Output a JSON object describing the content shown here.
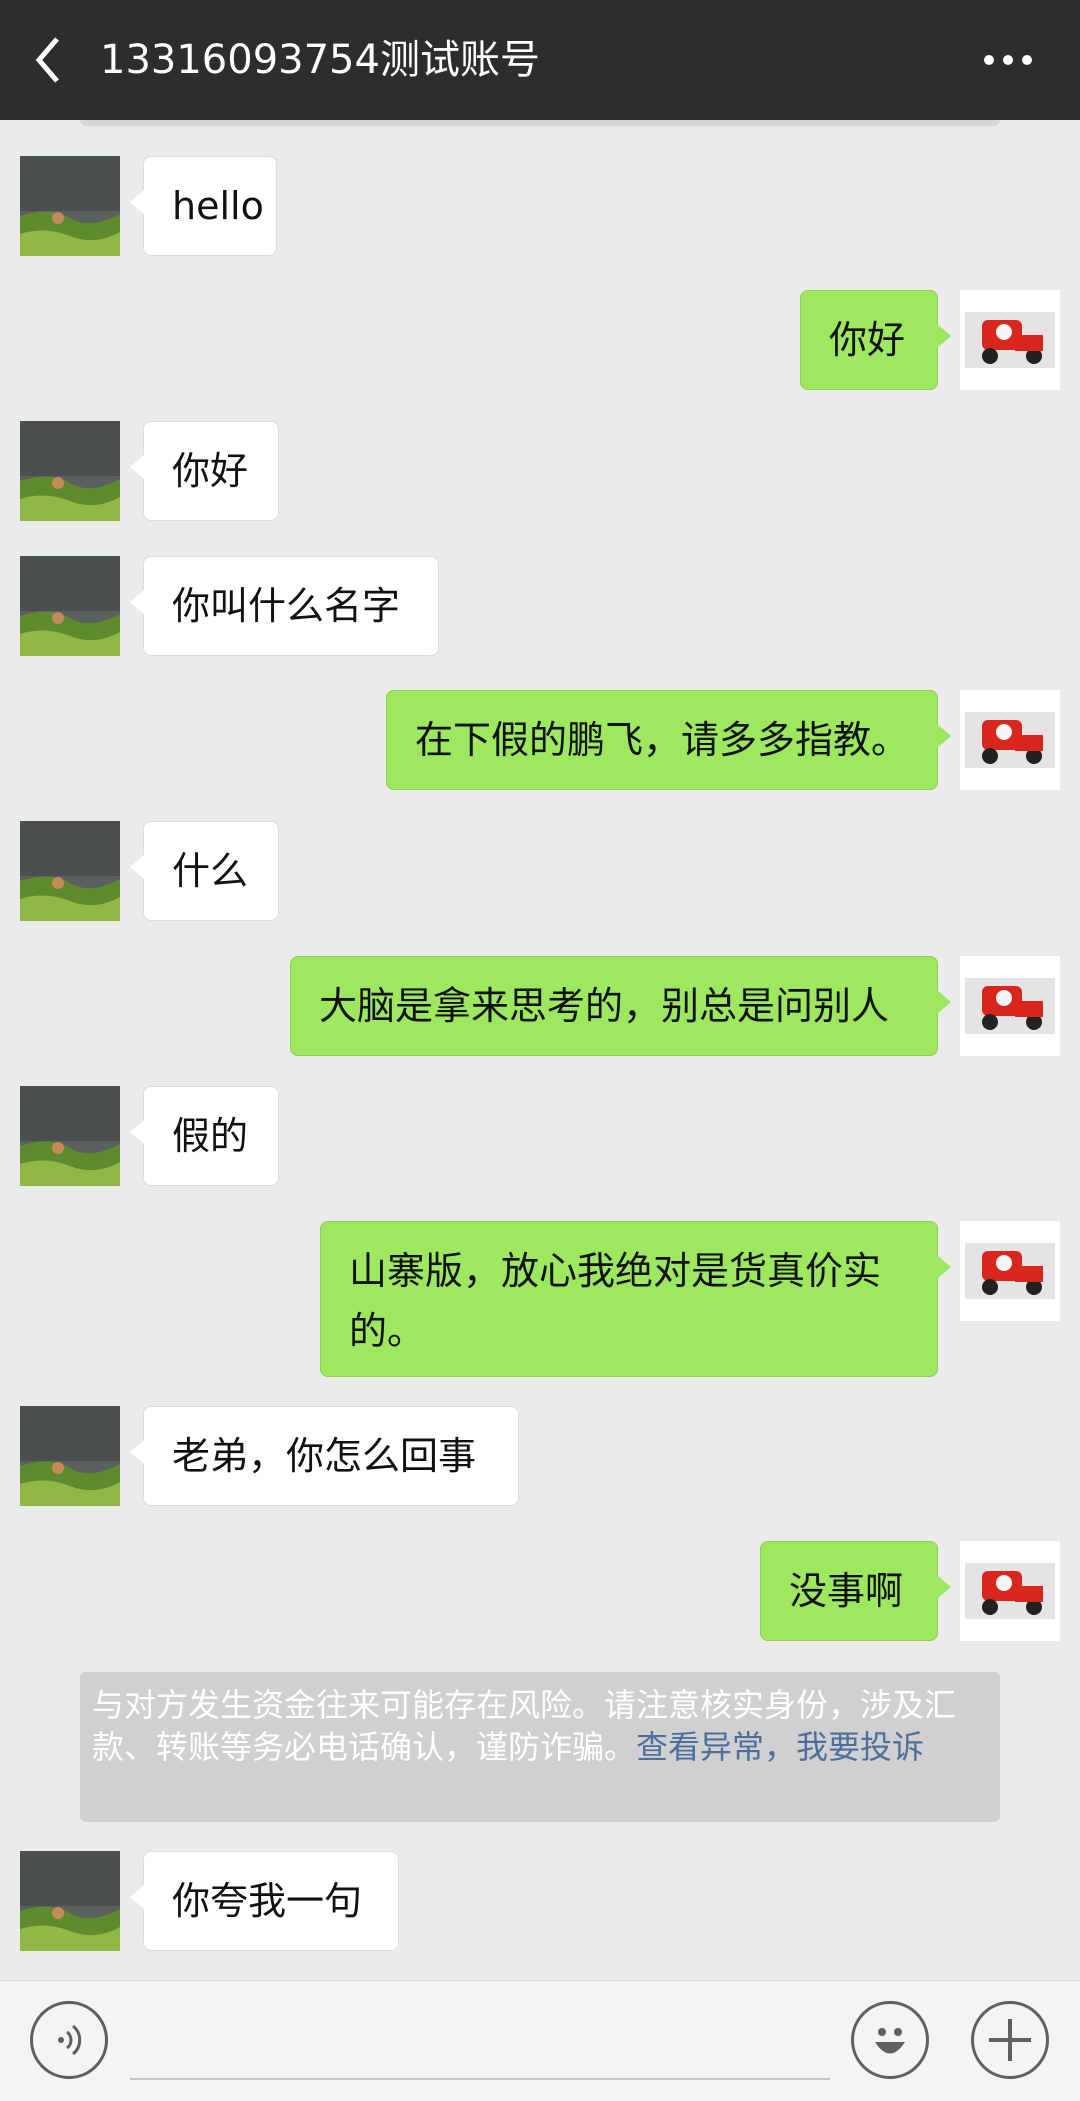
{
  "header": {
    "title": "13316093754测试账号"
  },
  "messages": [
    {
      "side": "left",
      "text": "hello"
    },
    {
      "side": "right",
      "text": "你好"
    },
    {
      "side": "left",
      "text": "你好"
    },
    {
      "side": "left",
      "text": "你叫什么名字"
    },
    {
      "side": "right",
      "text": "在下假的鹏飞，请多多指教。"
    },
    {
      "side": "left",
      "text": "什么"
    },
    {
      "side": "right",
      "text": "大脑是拿来思考的，别总是问别人"
    },
    {
      "side": "left",
      "text": "假的"
    },
    {
      "side": "right",
      "text": "山寨版，放心我绝对是货真价实的。"
    },
    {
      "side": "left",
      "text": "老弟，你怎么回事"
    },
    {
      "side": "right",
      "text": "没事啊"
    },
    {
      "side": "left",
      "text": "你夸我一句"
    }
  ],
  "notice": {
    "text": "与对方发生资金往来可能存在风险。请注意核实身份，涉及汇款、转账等务必电话确认，谨防诈骗。",
    "link1": "查看异常",
    "sep": "，",
    "link2": "我要投诉"
  },
  "colors": {
    "header_bg": "#2d2d2d",
    "chat_bg": "#ebebeb",
    "own_bubble": "#9de85e",
    "other_bubble": "#ffffff",
    "link": "#4e6f9c"
  },
  "icons": {
    "back": "back-arrow-icon",
    "more": "more-dots-icon",
    "voice": "voice-icon",
    "emoji": "emoji-icon",
    "plus": "plus-icon"
  }
}
